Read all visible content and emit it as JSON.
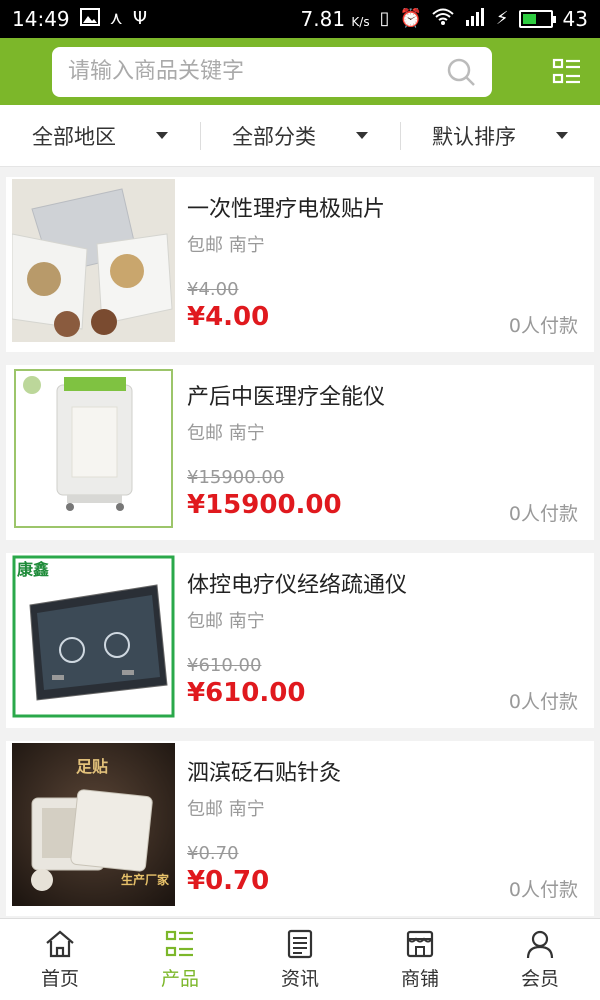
{
  "status_bar": {
    "time": "14:49",
    "speed": "7.81",
    "speed_unit": "K/s",
    "battery": "43"
  },
  "search": {
    "placeholder": "请输入商品关键字"
  },
  "filters": [
    {
      "label": "全部地区"
    },
    {
      "label": "全部分类"
    },
    {
      "label": "默认排序"
    }
  ],
  "products": [
    {
      "title": "一次性理疗电极贴片",
      "shipping": "包邮 南宁",
      "old_price": "¥4.00",
      "price": "¥4.00",
      "paid": "0人付款"
    },
    {
      "title": "产后中医理疗全能仪",
      "shipping": "包邮 南宁",
      "old_price": "¥15900.00",
      "price": "¥15900.00",
      "paid": "0人付款"
    },
    {
      "title": "体控电疗仪经络疏通仪",
      "shipping": "包邮 南宁",
      "old_price": "¥610.00",
      "price": "¥610.00",
      "paid": "0人付款",
      "image_brand": "康鑫"
    },
    {
      "title": "泗滨砭石贴针灸",
      "shipping": "包邮 南宁",
      "old_price": "¥0.70",
      "price": "¥0.70",
      "paid": "0人付款",
      "image_caption": "足贴",
      "image_tag": "生产厂家"
    }
  ],
  "nav": [
    {
      "label": "首页",
      "icon": "home-icon"
    },
    {
      "label": "产品",
      "icon": "grid-list-icon"
    },
    {
      "label": "资讯",
      "icon": "news-icon"
    },
    {
      "label": "商铺",
      "icon": "store-icon"
    },
    {
      "label": "会员",
      "icon": "user-icon"
    }
  ],
  "colors": {
    "brand_green": "#7cb72a",
    "price_red": "#e0191e"
  }
}
